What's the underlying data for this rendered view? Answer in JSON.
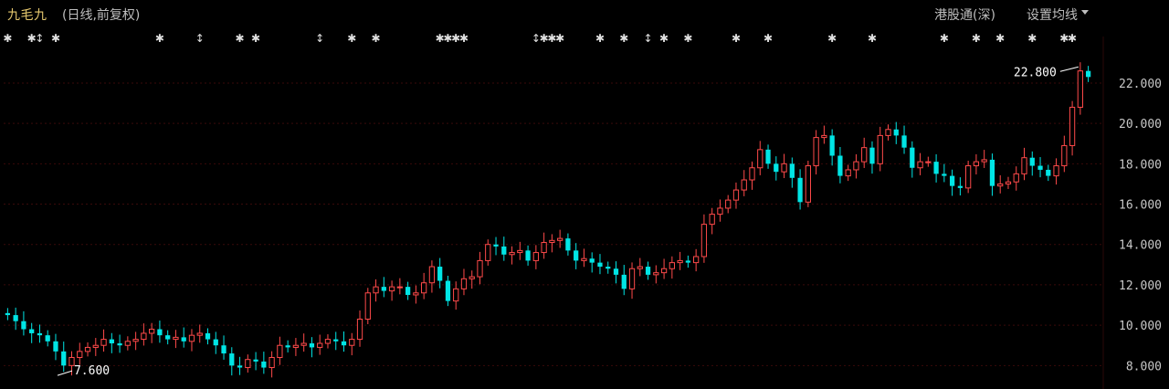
{
  "header": {
    "stock_name": "九毛九",
    "subtitle": "(日线,前复权)",
    "hk_connect": "港股通(深)",
    "ma_settings": "设置均线"
  },
  "colors": {
    "up": "#ff4a4a",
    "down": "#00e5e5",
    "grid": "#3a0a0a",
    "axis_text": "#c8c8c8",
    "marker": "#e0e0e0"
  },
  "event_markers": {
    "symbols": [
      "✱",
      "✱",
      "↕",
      "✱",
      "✱",
      "↕",
      "✱",
      "✱",
      "↕",
      "✱",
      "✱",
      "✱",
      "✱",
      "✱",
      "✱",
      "↕",
      "✱",
      "✱",
      "✱",
      "✱",
      "✱",
      "↕",
      "✱",
      "✱",
      "✱",
      "✱",
      "✱",
      "✱",
      "✱",
      "✱",
      "✱",
      "✱",
      "✱",
      "✱"
    ],
    "day_index": [
      0,
      3,
      4,
      6,
      19,
      24,
      29,
      31,
      39,
      43,
      46,
      54,
      55,
      56,
      57,
      66,
      67,
      68,
      69,
      74,
      77,
      80,
      82,
      85,
      91,
      95,
      103,
      108,
      117,
      121,
      124,
      128,
      132,
      133
    ]
  },
  "chart_data": {
    "type": "candlestick",
    "title": "",
    "xlabel": "",
    "ylabel": "",
    "ylim": [
      7.2,
      23.4
    ],
    "yticks": [
      "8.000",
      "10.000",
      "12.000",
      "14.000",
      "16.000",
      "18.000",
      "20.000",
      "22.000"
    ],
    "grid": true,
    "annotations": [
      {
        "label": "22.800",
        "value": 22.8,
        "day_index": 134
      },
      {
        "label": "7.600",
        "value": 7.6,
        "day_index": 6
      }
    ],
    "close": [
      10.5,
      10.2,
      9.8,
      9.6,
      9.5,
      9.2,
      8.7,
      8.0,
      8.4,
      8.7,
      8.9,
      9.0,
      9.3,
      9.1,
      9.0,
      9.2,
      9.3,
      9.6,
      9.8,
      9.5,
      9.3,
      9.4,
      9.2,
      9.5,
      9.6,
      9.3,
      9.0,
      8.6,
      8.0,
      7.9,
      8.3,
      8.2,
      7.9,
      8.4,
      9.0,
      8.9,
      9.0,
      9.1,
      8.9,
      9.1,
      9.3,
      9.2,
      9.0,
      9.3,
      10.3,
      11.6,
      11.9,
      11.7,
      11.9,
      11.9,
      11.5,
      11.6,
      12.1,
      12.9,
      12.2,
      11.2,
      11.8,
      12.3,
      12.4,
      13.2,
      14.0,
      13.9,
      13.5,
      13.6,
      13.7,
      13.2,
      13.6,
      14.1,
      14.2,
      14.3,
      13.7,
      13.2,
      13.3,
      13.1,
      12.9,
      12.8,
      12.5,
      11.8,
      12.8,
      12.9,
      12.5,
      12.6,
      12.8,
      13.1,
      13.2,
      13.1,
      13.4,
      15.0,
      15.5,
      15.8,
      16.2,
      16.7,
      17.2,
      17.8,
      18.7,
      18.0,
      17.6,
      18.0,
      17.3,
      16.1,
      17.9,
      19.3,
      19.4,
      18.4,
      17.4,
      17.7,
      18.1,
      18.8,
      18.0,
      19.4,
      19.7,
      19.4,
      18.8,
      17.8,
      18.1,
      18.1,
      17.5,
      17.4,
      16.9,
      16.8,
      17.9,
      18.1,
      18.2,
      16.9,
      17.0,
      17.1,
      17.5,
      18.3,
      17.9,
      17.7,
      17.4,
      17.9,
      18.9,
      20.8,
      22.6,
      22.3
    ],
    "open": [
      10.6,
      10.5,
      10.2,
      9.8,
      9.6,
      9.5,
      9.2,
      8.7,
      8.0,
      8.4,
      8.7,
      8.9,
      9.0,
      9.3,
      9.1,
      9.0,
      9.2,
      9.3,
      9.6,
      9.8,
      9.5,
      9.3,
      9.4,
      9.2,
      9.5,
      9.6,
      9.3,
      9.0,
      8.6,
      8.0,
      7.9,
      8.3,
      8.2,
      7.9,
      8.4,
      9.0,
      8.9,
      9.0,
      9.1,
      8.9,
      9.1,
      9.3,
      9.2,
      9.0,
      9.3,
      10.3,
      11.6,
      11.9,
      11.7,
      11.9,
      11.9,
      11.5,
      11.6,
      12.1,
      12.9,
      12.2,
      11.2,
      11.8,
      12.3,
      12.4,
      13.2,
      14.0,
      13.9,
      13.5,
      13.6,
      13.7,
      13.2,
      13.6,
      14.1,
      14.2,
      14.3,
      13.7,
      13.2,
      13.3,
      13.1,
      12.9,
      12.8,
      12.5,
      11.8,
      12.8,
      12.9,
      12.5,
      12.6,
      12.8,
      13.1,
      13.2,
      13.1,
      13.4,
      15.0,
      15.5,
      15.8,
      16.2,
      16.7,
      17.2,
      17.8,
      18.7,
      18.0,
      17.6,
      18.0,
      17.3,
      16.1,
      17.9,
      19.3,
      19.4,
      18.4,
      17.4,
      17.7,
      18.1,
      18.8,
      18.0,
      19.4,
      19.7,
      19.4,
      18.8,
      17.8,
      18.1,
      18.1,
      17.5,
      17.4,
      16.9,
      16.8,
      17.9,
      18.1,
      18.2,
      16.9,
      17.0,
      17.1,
      17.5,
      18.3,
      17.9,
      17.7,
      17.4,
      17.9,
      18.9,
      20.8,
      22.6
    ]
  }
}
